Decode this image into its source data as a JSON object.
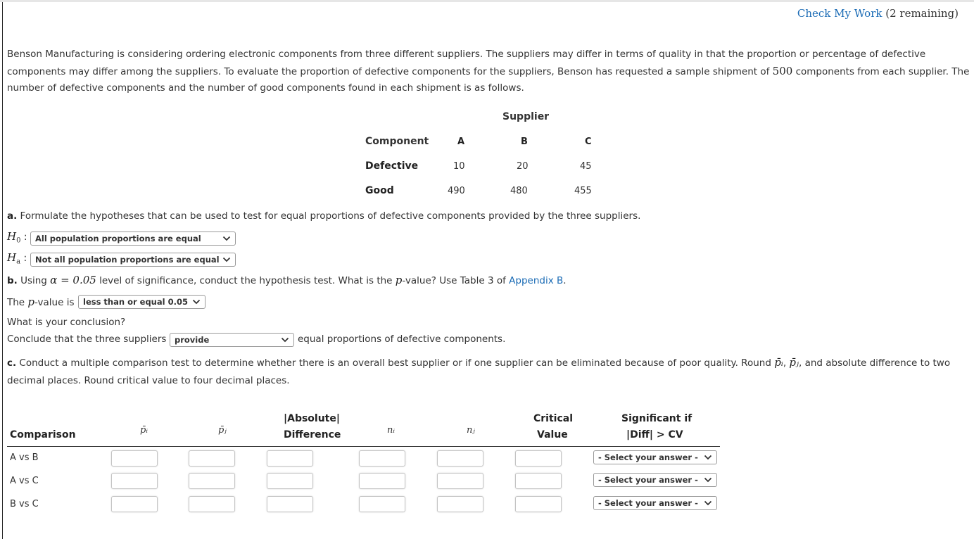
{
  "header": {
    "check_link": "Check My Work",
    "remaining": "(2 remaining)"
  },
  "intro": {
    "part1": "Benson Manufacturing is considering ordering electronic components from three different suppliers. The suppliers may differ in terms of quality in that the proportion or percentage of defective components may differ among the suppliers. To evaluate the proportion of defective components for the suppliers, Benson has requested a sample shipment of ",
    "sample_size": "500",
    "part2": " components from each supplier. The number of defective components and the number of good components found in each shipment is as follows."
  },
  "data_table": {
    "supplier_header": "Supplier",
    "component_header": "Component",
    "suppliers": [
      "A",
      "B",
      "C"
    ],
    "rows": [
      {
        "label": "Defective",
        "values": [
          "10",
          "20",
          "45"
        ]
      },
      {
        "label": "Good",
        "values": [
          "490",
          "480",
          "455"
        ]
      }
    ]
  },
  "part_a": {
    "label": "a.",
    "text": " Formulate the hypotheses that can be used to test for equal proportions of defective components provided by the three suppliers.",
    "h0_symbol": "H",
    "h0_sub": "0",
    "h0_value": "All population proportions are equal",
    "ha_symbol": "H",
    "ha_sub": "a",
    "ha_value": "Not all population proportions are equal"
  },
  "part_b": {
    "label": "b.",
    "text1": " Using ",
    "alpha": "α = 0.05",
    "text2": " level of significance, conduct the hypothesis test. What is the ",
    "p": "p",
    "text3": "-value? Use Table 3 of ",
    "link": "Appendix B",
    "text4": ".",
    "pvalue_prefix": "The ",
    "pvalue_mid": "-value is",
    "pvalue_selected": "less than or equal 0.05",
    "conclusion_question": "What is your conclusion?",
    "conclusion_prefix": "Conclude that the three suppliers",
    "conclusion_selected": "provide",
    "conclusion_suffix": "equal proportions of defective components."
  },
  "part_c": {
    "label": "c.",
    "text1": " Conduct a multiple comparison test to determine whether there is an overall best supplier or if one supplier can be eliminated because of poor quality. Round ",
    "pi": "p̄ᵢ",
    "pj": "p̄ⱼ",
    "text2": ", and absolute difference to two decimal places. Round critical value to four decimal places.",
    "columns": {
      "comparison": "Comparison",
      "pi": "p̄ᵢ",
      "pj": "p̄ⱼ",
      "absdiff_1": "|Absolute|",
      "absdiff_2": "Difference",
      "ni": "nᵢ",
      "nj": "nⱼ",
      "cv_1": "Critical",
      "cv_2": "Value",
      "sig_1": "Significant if",
      "sig_2": "|Diff| > CV"
    },
    "rows": [
      {
        "comparison": "A vs B",
        "pi": "",
        "pj": "",
        "absdiff": "",
        "ni": "",
        "nj": "",
        "cv": "",
        "significant": "- Select your answer -"
      },
      {
        "comparison": "A vs C",
        "pi": "",
        "pj": "",
        "absdiff": "",
        "ni": "",
        "nj": "",
        "cv": "",
        "significant": "- Select your answer -"
      },
      {
        "comparison": "B vs C",
        "pi": "",
        "pj": "",
        "absdiff": "",
        "ni": "",
        "nj": "",
        "cv": "",
        "significant": "- Select your answer -"
      }
    ]
  },
  "colors": {
    "link": "#1a6bb5",
    "teal_header": "#2fbfbf"
  }
}
